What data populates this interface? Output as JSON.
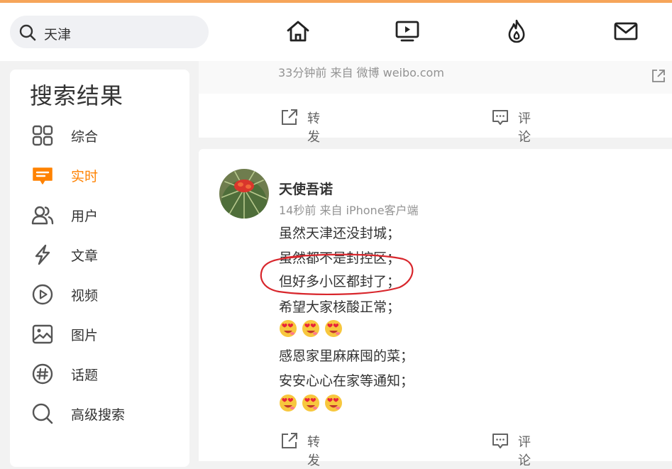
{
  "search": {
    "value": "天津"
  },
  "nav": {
    "items": [
      {
        "name": "home",
        "icon": "home-icon"
      },
      {
        "name": "video",
        "icon": "tv-play-icon"
      },
      {
        "name": "hot",
        "icon": "fire-icon"
      },
      {
        "name": "messages",
        "icon": "mail-icon"
      }
    ]
  },
  "sidebar": {
    "title": "搜索结果",
    "items": [
      {
        "label": "综合",
        "icon": "grid-icon"
      },
      {
        "label": "实时",
        "icon": "realtime-icon",
        "active": true
      },
      {
        "label": "用户",
        "icon": "users-icon"
      },
      {
        "label": "文章",
        "icon": "lightning-icon"
      },
      {
        "label": "视频",
        "icon": "play-circle-icon"
      },
      {
        "label": "图片",
        "icon": "image-icon"
      },
      {
        "label": "话题",
        "icon": "hashtag-icon"
      },
      {
        "label": "高级搜索",
        "icon": "search-icon"
      }
    ]
  },
  "prev_post": {
    "meta": "33分钟前 来自 微博 weibo.com",
    "actions": {
      "repost": "转发",
      "comment": "评论"
    }
  },
  "post": {
    "author": "天使吾诺",
    "meta": "14秒前 来自 iPhone客户端",
    "lines": [
      "虽然天津还没封城；",
      "虽然都不是封控区；",
      "但好多小区都封了；",
      "希望大家核酸正常；",
      "感恩家里麻麻囤的菜；",
      "安安心心在家等通知；"
    ],
    "actions": {
      "repost": "转发",
      "comment": "评论"
    }
  },
  "colors": {
    "accent": "#ff8200",
    "annotation": "#d8262c",
    "top_line": "#f6a55a"
  }
}
